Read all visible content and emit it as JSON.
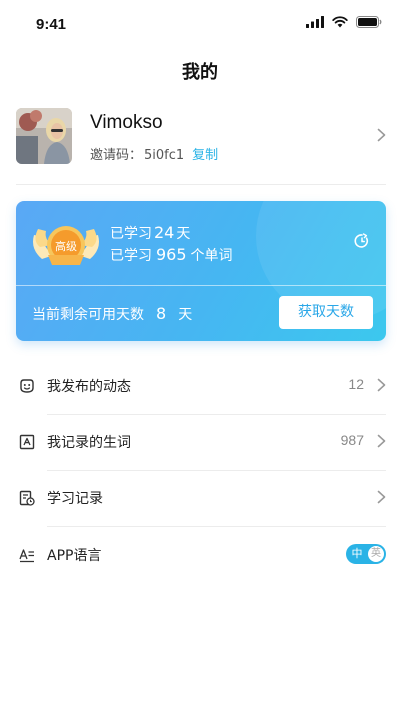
{
  "status_bar": {
    "time": "9:41"
  },
  "header": {
    "title": "我的"
  },
  "profile": {
    "name": "Vimokso",
    "invite_label": "邀请码：",
    "invite_code": "5i0fc1",
    "copy_label": "复制"
  },
  "study_card": {
    "badge_label": "高级",
    "studied_prefix": "已学习",
    "studied_days": "24",
    "studied_days_unit": "天",
    "words_prefix": "已学习",
    "words_count": "965",
    "words_unit": "个单词",
    "remaining_label": "当前剩余可用天数",
    "remaining_days": "8",
    "remaining_unit": "天",
    "get_days_button": "获取天数"
  },
  "menu": {
    "items": [
      {
        "label": "我发布的动态",
        "count": "12",
        "icon": "emoji-icon"
      },
      {
        "label": "我记录的生词",
        "count": "987",
        "icon": "vocab-icon"
      },
      {
        "label": "学习记录",
        "count": "",
        "icon": "study-record-icon"
      },
      {
        "label": "APP语言",
        "icon": "language-icon"
      }
    ],
    "language_toggle": {
      "zh": "中",
      "en": "英",
      "selected": "中"
    }
  },
  "colors": {
    "accent": "#2ab3e6",
    "card_start": "#5aa8f5",
    "card_end": "#3cc8ee"
  }
}
